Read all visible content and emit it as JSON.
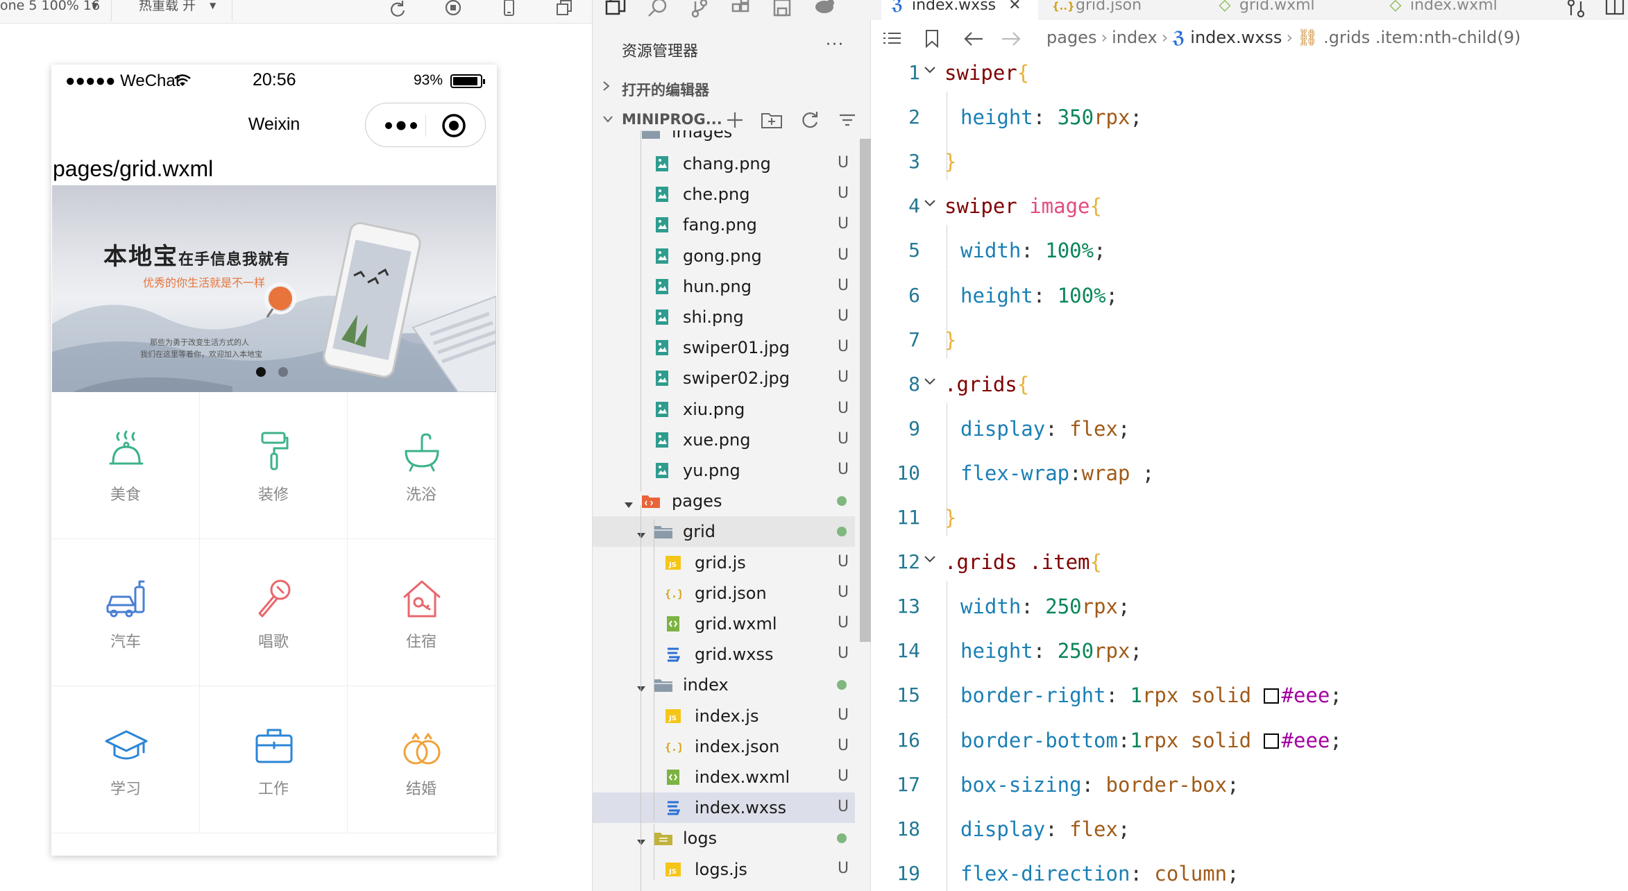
{
  "simulator": {
    "toolbar": {
      "device_text": "one 5 100% 16",
      "mode_text": "热重载 开"
    },
    "status_bar": {
      "carrier": "●●●●● WeChat",
      "time": "20:56",
      "battery_pct": "93%",
      "battery_level": 0.93
    },
    "nav_title": "Weixin",
    "page_path": "pages/grid.wxml",
    "banner": {
      "title": "本地宝",
      "title_suffix": "在手信息我就有",
      "subtitle": "优秀的你生活就是不一样",
      "desc_line1": "那些为勇于改变生活方式的人",
      "desc_line2": "我们在这里等着你，欢迎加入本地宝",
      "slide_count": 2,
      "active_slide": 1
    },
    "grid_items": [
      {
        "label": "美食",
        "icon": "food-cloche-icon",
        "color": "#3cb28b"
      },
      {
        "label": "装修",
        "icon": "paint-roller-icon",
        "color": "#3cb28b"
      },
      {
        "label": "洗浴",
        "icon": "bath-icon",
        "color": "#3cb28b"
      },
      {
        "label": "汽车",
        "icon": "car-wash-icon",
        "color": "#4a7fd4"
      },
      {
        "label": "唱歌",
        "icon": "microphone-icon",
        "color": "#e9676b"
      },
      {
        "label": "住宿",
        "icon": "house-key-icon",
        "color": "#e9676b"
      },
      {
        "label": "学习",
        "icon": "graduation-cap-icon",
        "color": "#2b86d6"
      },
      {
        "label": "工作",
        "icon": "briefcase-icon",
        "color": "#2b86d6"
      },
      {
        "label": "结婚",
        "icon": "wedding-rings-icon",
        "color": "#f0a23a"
      }
    ]
  },
  "explorer": {
    "title": "资源管理器",
    "more": "···",
    "open_editors": "打开的编辑器",
    "project": "MINIPROG...",
    "partial_folder": "images",
    "rows": [
      {
        "name": "chang.png",
        "kind": "image",
        "depth": 1,
        "status": "U"
      },
      {
        "name": "che.png",
        "kind": "image",
        "depth": 1,
        "status": "U"
      },
      {
        "name": "fang.png",
        "kind": "image",
        "depth": 1,
        "status": "U"
      },
      {
        "name": "gong.png",
        "kind": "image",
        "depth": 1,
        "status": "U"
      },
      {
        "name": "hun.png",
        "kind": "image",
        "depth": 1,
        "status": "U"
      },
      {
        "name": "shi.png",
        "kind": "image",
        "depth": 1,
        "status": "U"
      },
      {
        "name": "swiper01.jpg",
        "kind": "image",
        "depth": 1,
        "status": "U"
      },
      {
        "name": "swiper02.jpg",
        "kind": "image",
        "depth": 1,
        "status": "U"
      },
      {
        "name": "xiu.png",
        "kind": "image",
        "depth": 1,
        "status": "U"
      },
      {
        "name": "xue.png",
        "kind": "image",
        "depth": 1,
        "status": "U"
      },
      {
        "name": "yu.png",
        "kind": "image",
        "depth": 1,
        "status": "U"
      },
      {
        "name": "pages",
        "kind": "folder-pages",
        "depth": 0,
        "status": "dot"
      },
      {
        "name": "grid",
        "kind": "folder",
        "depth": 1,
        "status": "dot"
      },
      {
        "name": "grid.js",
        "kind": "js",
        "depth": 2,
        "status": "U"
      },
      {
        "name": "grid.json",
        "kind": "json",
        "depth": 2,
        "status": "U"
      },
      {
        "name": "grid.wxml",
        "kind": "wxml",
        "depth": 2,
        "status": "U"
      },
      {
        "name": "grid.wxss",
        "kind": "wxss",
        "depth": 2,
        "status": "U"
      },
      {
        "name": "index",
        "kind": "folder",
        "depth": 1,
        "status": "dot"
      },
      {
        "name": "index.js",
        "kind": "js",
        "depth": 2,
        "status": "U"
      },
      {
        "name": "index.json",
        "kind": "json",
        "depth": 2,
        "status": "U"
      },
      {
        "name": "index.wxml",
        "kind": "wxml",
        "depth": 2,
        "status": "U"
      },
      {
        "name": "index.wxss",
        "kind": "wxss",
        "depth": 2,
        "status": "U"
      },
      {
        "name": "logs",
        "kind": "folder-logs",
        "depth": 1,
        "status": "dot"
      },
      {
        "name": "logs.js",
        "kind": "js",
        "depth": 2,
        "status": "U"
      }
    ]
  },
  "editor": {
    "tabs": [
      {
        "label": "index.wxss",
        "kind": "wxss",
        "active": true
      },
      {
        "label": "grid.json",
        "kind": "json",
        "active": false
      },
      {
        "label": "grid.wxml",
        "kind": "wxml",
        "active": false
      },
      {
        "label": "index.wxml",
        "kind": "wxml",
        "active": false
      }
    ],
    "breadcrumbs": [
      "pages",
      "index",
      "index.wxss",
      ".grids .item:nth-child(9)"
    ],
    "code_lines": [
      [
        [
          "sel",
          "swiper"
        ],
        [
          "brace",
          "{"
        ]
      ],
      [
        [
          "prop",
          "height"
        ],
        [
          "punc",
          ": "
        ],
        [
          "num",
          "350"
        ],
        [
          "val",
          "rpx"
        ],
        [
          "punc",
          ";"
        ]
      ],
      [
        [
          "brace",
          "}"
        ]
      ],
      [
        [
          "sel",
          "swiper "
        ],
        [
          "tag",
          "image"
        ],
        [
          "brace",
          "{"
        ]
      ],
      [
        [
          "prop",
          "width"
        ],
        [
          "punc",
          ": "
        ],
        [
          "num",
          "100%"
        ],
        [
          "punc",
          ";"
        ]
      ],
      [
        [
          "prop",
          "height"
        ],
        [
          "punc",
          ": "
        ],
        [
          "num",
          "100%"
        ],
        [
          "punc",
          ";"
        ]
      ],
      [
        [
          "brace",
          "}"
        ]
      ],
      [
        [
          "cls",
          ".grids"
        ],
        [
          "brace",
          "{"
        ]
      ],
      [
        [
          "prop",
          "display"
        ],
        [
          "punc",
          ": "
        ],
        [
          "val",
          "flex"
        ],
        [
          "punc",
          ";"
        ]
      ],
      [
        [
          "prop",
          "flex-wrap"
        ],
        [
          "punc",
          ":"
        ],
        [
          "val",
          "wrap"
        ],
        [
          "punc",
          " ;"
        ]
      ],
      [
        [
          "brace",
          "}"
        ]
      ],
      [
        [
          "cls",
          ".grids .item"
        ],
        [
          "brace",
          "{"
        ]
      ],
      [
        [
          "prop",
          "width"
        ],
        [
          "punc",
          ": "
        ],
        [
          "num",
          "250"
        ],
        [
          "val",
          "rpx"
        ],
        [
          "punc",
          ";"
        ]
      ],
      [
        [
          "prop",
          "height"
        ],
        [
          "punc",
          ": "
        ],
        [
          "num",
          "250"
        ],
        [
          "val",
          "rpx"
        ],
        [
          "punc",
          ";"
        ]
      ],
      [
        [
          "prop",
          "border-right"
        ],
        [
          "punc",
          ": "
        ],
        [
          "num",
          "1"
        ],
        [
          "val",
          "rpx solid "
        ],
        [
          "swatch",
          ""
        ],
        [
          "hex",
          "#eee"
        ],
        [
          "punc",
          ";"
        ]
      ],
      [
        [
          "prop",
          "border-bottom"
        ],
        [
          "punc",
          ":"
        ],
        [
          "num",
          "1"
        ],
        [
          "val",
          "rpx solid "
        ],
        [
          "swatch",
          ""
        ],
        [
          "hex",
          "#eee"
        ],
        [
          "punc",
          ";"
        ]
      ],
      [
        [
          "prop",
          "box-sizing"
        ],
        [
          "punc",
          ": "
        ],
        [
          "val",
          "border-box"
        ],
        [
          "punc",
          ";"
        ]
      ],
      [
        [
          "prop",
          "display"
        ],
        [
          "punc",
          ": "
        ],
        [
          "val",
          "flex"
        ],
        [
          "punc",
          ";"
        ]
      ],
      [
        [
          "prop",
          "flex-direction"
        ],
        [
          "punc",
          ": "
        ],
        [
          "val",
          "column"
        ],
        [
          "punc",
          ";"
        ]
      ]
    ]
  }
}
